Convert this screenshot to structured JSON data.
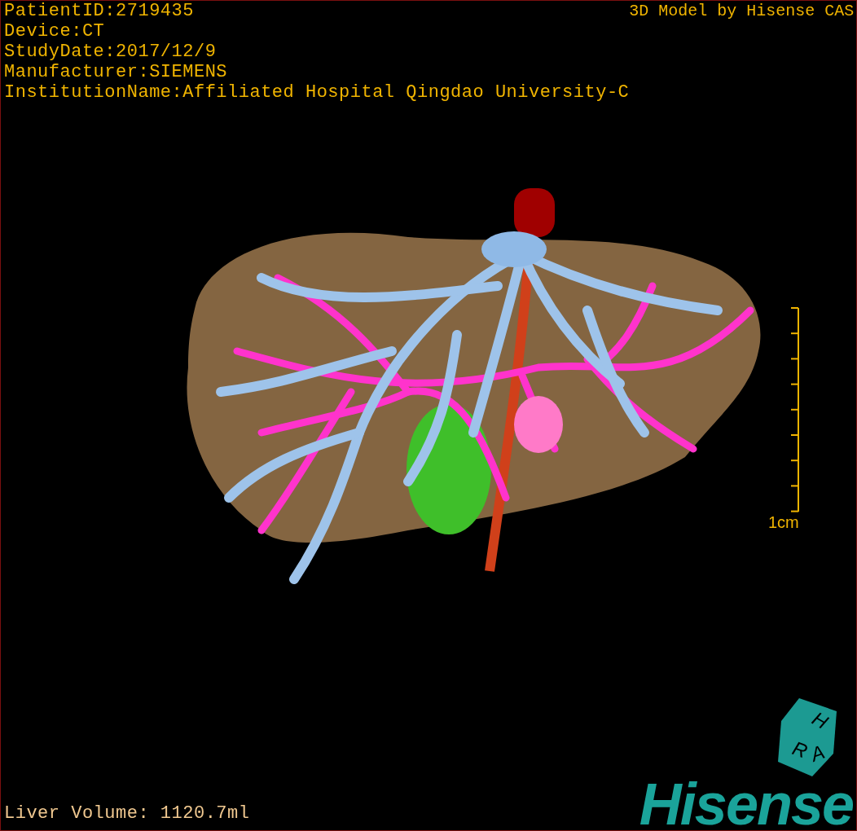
{
  "info_lines": [
    "PatientID:2719435",
    "Device:CT",
    "StudyDate:2017/12/9",
    "Manufacturer:SIEMENS",
    "InstitutionName:Affiliated Hospital Qingdao University-C"
  ],
  "title": "3D Model by Hisense CAS",
  "scale": {
    "label": "1cm"
  },
  "measurement": "Liver Volume: 1120.7ml",
  "orientation_cube": {
    "faces": [
      "H",
      "R",
      "A"
    ]
  },
  "logo": "Hisense"
}
